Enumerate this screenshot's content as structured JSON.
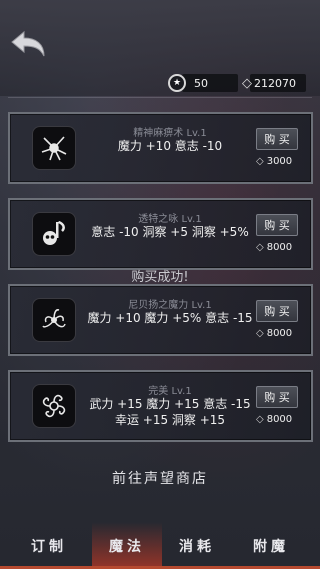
{
  "header": {
    "reputation": "50",
    "gems": "212070"
  },
  "items": [
    {
      "name": "精神麻痹术 Lv.1",
      "stats": [
        "魔力 +10  意志 -10"
      ],
      "buy_label": "购 买",
      "price": "3000",
      "icon": "shatter-icon"
    },
    {
      "name": "透特之咏 Lv.1",
      "stats": [
        "意志 -10  洞察 +5  洞察 +5%"
      ],
      "buy_label": "购 买",
      "price": "8000",
      "icon": "skull-note-icon"
    },
    {
      "name": "尼贝扬之魔力 Lv.1",
      "stats": [
        "魔力 +10  魔力 +5%  意志 -15"
      ],
      "buy_label": "购 买",
      "price": "8000",
      "icon": "tentacle-icon"
    },
    {
      "name": "完美 Lv.1",
      "stats": [
        "武力 +15  魔力 +15  意志 -15",
        "幸运 +15  洞察 +15"
      ],
      "buy_label": "购 买",
      "price": "8000",
      "icon": "swirl-icon"
    }
  ],
  "toast": "购买成功!",
  "reputation_shop_link": "前往声望商店",
  "tabs": [
    {
      "label": "订制",
      "active": false
    },
    {
      "label": "魔法",
      "active": true
    },
    {
      "label": "消耗",
      "active": false
    },
    {
      "label": "附魔",
      "active": false
    }
  ],
  "colors": {
    "active_tab": "#b64a30",
    "card_border": "#6c7078"
  }
}
